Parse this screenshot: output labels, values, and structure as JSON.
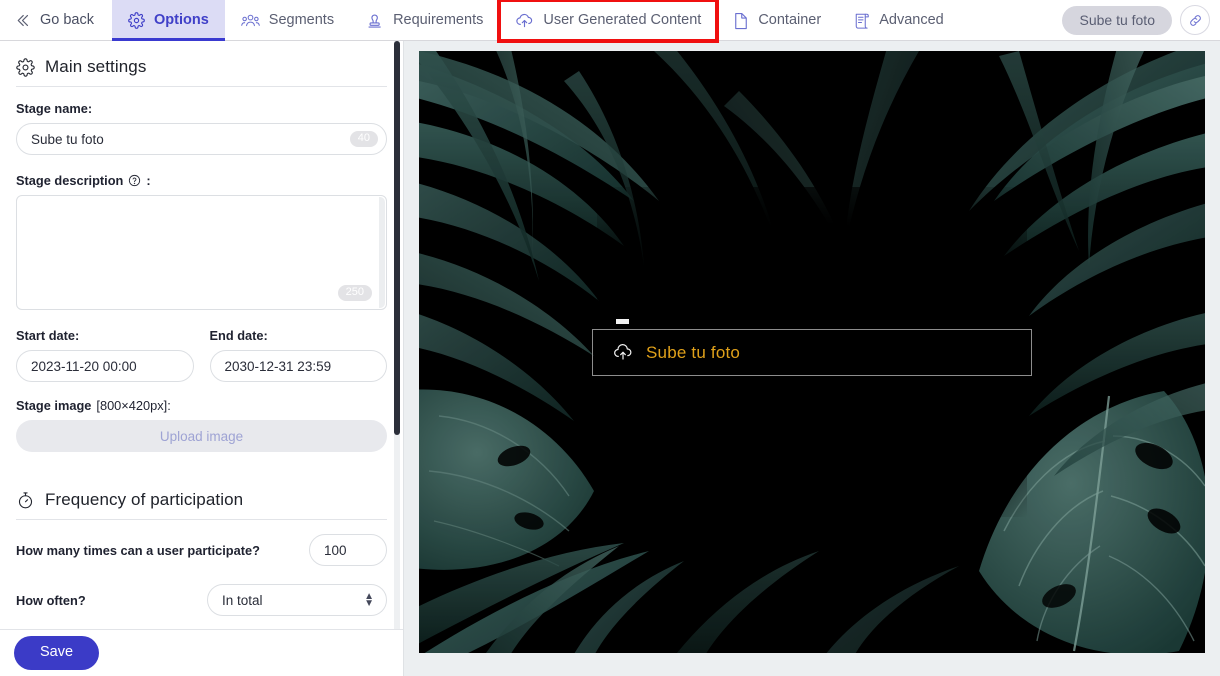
{
  "toolbar": {
    "tabs": [
      {
        "label": "Go back",
        "icon": "chevrons-left-icon",
        "state": "normal"
      },
      {
        "label": "Options",
        "icon": "gear-icon",
        "state": "active"
      },
      {
        "label": "Segments",
        "icon": "people-group-icon",
        "state": "normal"
      },
      {
        "label": "Requirements",
        "icon": "stamp-icon",
        "state": "normal"
      },
      {
        "label": "User Generated Content",
        "icon": "cloud-upload-icon",
        "state": "highlighted"
      },
      {
        "label": "Container",
        "icon": "page-icon",
        "state": "normal"
      },
      {
        "label": "Advanced",
        "icon": "scroll-icon",
        "state": "normal"
      }
    ],
    "stage_pill_label": "Sube tu foto",
    "link_icon": "link-icon",
    "active_color": "#4040c8",
    "active_bg": "#dcdcf5",
    "highlight_color": "#f01010"
  },
  "sidebar": {
    "main_settings": {
      "icon": "gear-icon",
      "title": "Main settings",
      "stage_name": {
        "label": "Stage name:",
        "value": "Sube tu foto",
        "counter": "40"
      },
      "stage_description": {
        "label": "Stage description",
        "help_icon": "help-circle-icon",
        "colon": ":",
        "value": "",
        "counter": "250"
      },
      "start_date": {
        "label": "Start date:",
        "value": "2023-11-20 00:00"
      },
      "end_date": {
        "label": "End date:",
        "value": "2030-12-31 23:59"
      },
      "stage_image": {
        "label": "Stage image",
        "dimensions": "[800×420px]:",
        "upload_label": "Upload image"
      }
    },
    "frequency": {
      "icon": "stopwatch-icon",
      "title": "Frequency of participation",
      "times_label": "How many times can a user participate?",
      "times_value": "100",
      "how_often_label": "How often?",
      "how_often_value": "In total"
    },
    "save_label": "Save",
    "save_color": "#3b3bc7"
  },
  "preview": {
    "upload_widget": {
      "label": "Sube tu foto",
      "icon": "cloud-upload-icon",
      "text_color": "#e0a11a",
      "border_color": "#8d8d8d"
    },
    "background": "tropical-leaves-dark"
  }
}
